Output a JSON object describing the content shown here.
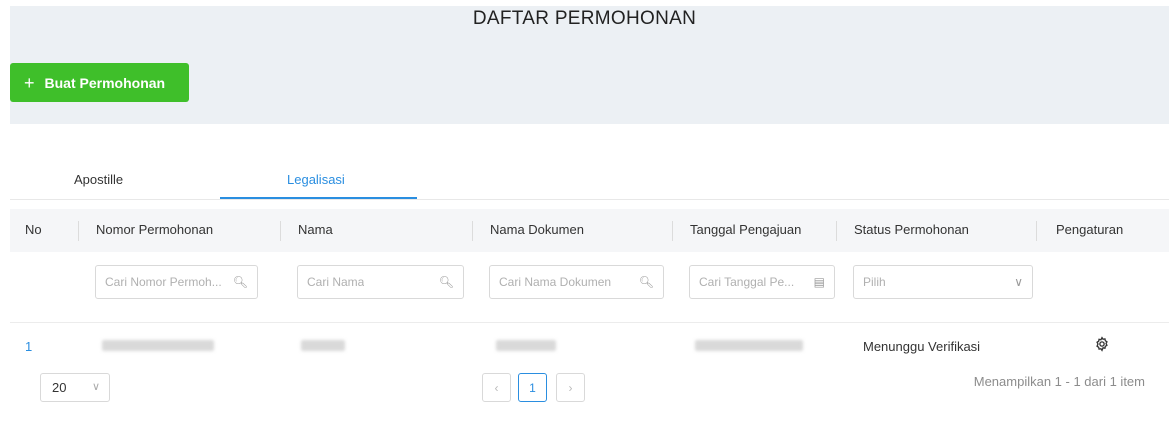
{
  "header": {
    "title": "DAFTAR PERMOHONAN",
    "create_button": "Buat Permohonan",
    "create_icon": "+"
  },
  "tabs": [
    {
      "label": "Apostille",
      "active": false
    },
    {
      "label": "Legalisasi",
      "active": true
    }
  ],
  "table": {
    "columns": [
      "No",
      "Nomor Permohonan",
      "Nama",
      "Nama Dokumen",
      "Tanggal Pengajuan",
      "Status Permohonan",
      "Pengaturan"
    ],
    "filters": {
      "nomor_placeholder": "Cari Nomor Permoh...",
      "nama_placeholder": "Cari Nama",
      "dokumen_placeholder": "Cari Nama Dokumen",
      "tanggal_placeholder": "Cari Tanggal Pe...",
      "status_placeholder": "Pilih"
    },
    "rows": [
      {
        "no": "1",
        "status": "Menunggu Verifikasi",
        "action_icon": "gear-icon"
      }
    ]
  },
  "pagination": {
    "page_size": "20",
    "current_page": "1",
    "range_text": "Menampilkan 1 - 1 dari 1 item"
  },
  "colors": {
    "primary_green": "#3fbf2a",
    "accent_blue": "#2a8ee0",
    "band_gray": "#ecf0f4"
  }
}
